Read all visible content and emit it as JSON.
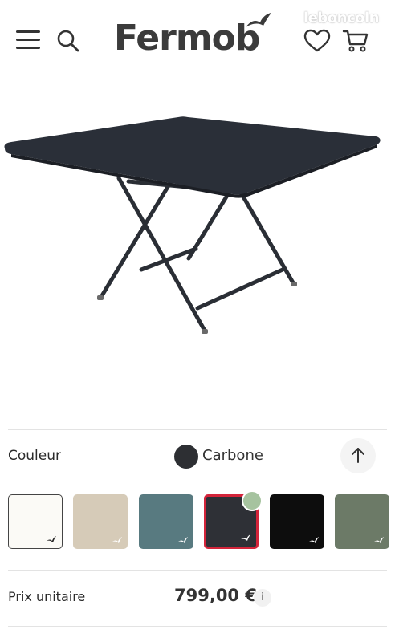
{
  "header": {
    "logo_text": "Fermob",
    "watermark": "leboncoin",
    "icons": [
      "menu-icon",
      "search-icon",
      "heart-icon",
      "cart-icon"
    ]
  },
  "product": {
    "image": "folding-table-icon",
    "color_label": "Couleur",
    "selected_color_name": "Carbone",
    "selected_color_hex": "#2d2f33",
    "swatches": [
      {
        "name": "white",
        "hex": "#fbfaf6",
        "selected": false
      },
      {
        "name": "beige",
        "hex": "#d6cbb8",
        "selected": false
      },
      {
        "name": "teal-gray",
        "hex": "#587a80",
        "selected": false
      },
      {
        "name": "carbone",
        "hex": "#2e3036",
        "selected": true
      },
      {
        "name": "black",
        "hex": "#0d0d0d",
        "selected": false
      },
      {
        "name": "sage-green",
        "hex": "#6c7a67",
        "selected": false
      }
    ],
    "accent_hex": "#d3243a",
    "price_label": "Prix unitaire",
    "price_value": "799,00 €",
    "info_label": "i"
  }
}
